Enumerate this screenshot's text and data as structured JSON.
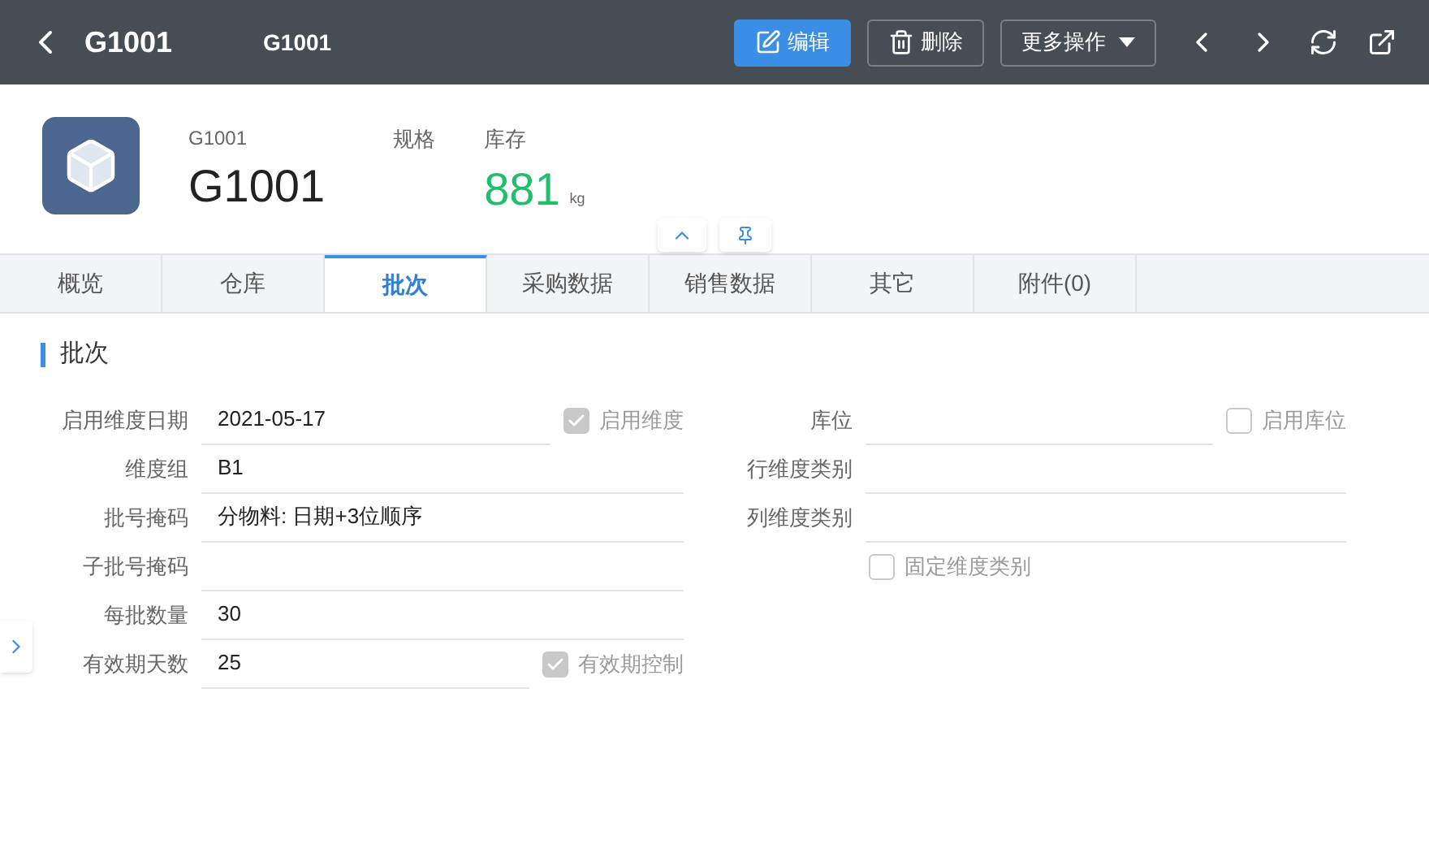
{
  "header": {
    "title": "G1001",
    "subtitle": "G1001",
    "actions": [
      {
        "kind": "primary",
        "label": "编辑"
      },
      {
        "kind": "outline",
        "label": "删除"
      },
      {
        "kind": "dropdown",
        "label": "更多操作"
      }
    ]
  },
  "summary": {
    "code_label": "G1001",
    "code": "G1001",
    "spec_label": "规格",
    "stock_label": "库存",
    "stock": "881",
    "unit": "kg"
  },
  "tabs": [
    {
      "label": "概览",
      "selected": false
    },
    {
      "label": "仓库",
      "selected": false
    },
    {
      "label": "批次",
      "selected": true
    },
    {
      "label": "采购数据",
      "selected": false
    },
    {
      "label": "销售数据",
      "selected": false
    },
    {
      "label": "其它",
      "selected": false
    },
    {
      "label": "附件(0)",
      "selected": false
    }
  ],
  "section_title": "批次",
  "left_fields": [
    {
      "label": "启用维度日期",
      "value": "2021-05-17",
      "checkbox": {
        "label": "启用维度",
        "checked": true
      }
    },
    {
      "label": "维度组",
      "value": "B1"
    },
    {
      "label": "批号掩码",
      "value": "分物料: 日期+3位顺序"
    },
    {
      "label": "子批号掩码"
    },
    {
      "label": "每批数量",
      "value": "30"
    },
    {
      "label": "有效期天数",
      "value": "25",
      "checkbox": {
        "label": "有效期控制",
        "checked": true
      }
    }
  ],
  "right_fields": [
    {
      "kind": "field",
      "label": "库位",
      "checkbox": {
        "label": "启用库位",
        "checked": false
      }
    },
    {
      "kind": "field",
      "label": "行维度类别"
    },
    {
      "kind": "field",
      "label": "列维度类别"
    },
    {
      "kind": "checkbox",
      "checkbox": {
        "label": "固定维度类别",
        "checked": false
      }
    }
  ]
}
